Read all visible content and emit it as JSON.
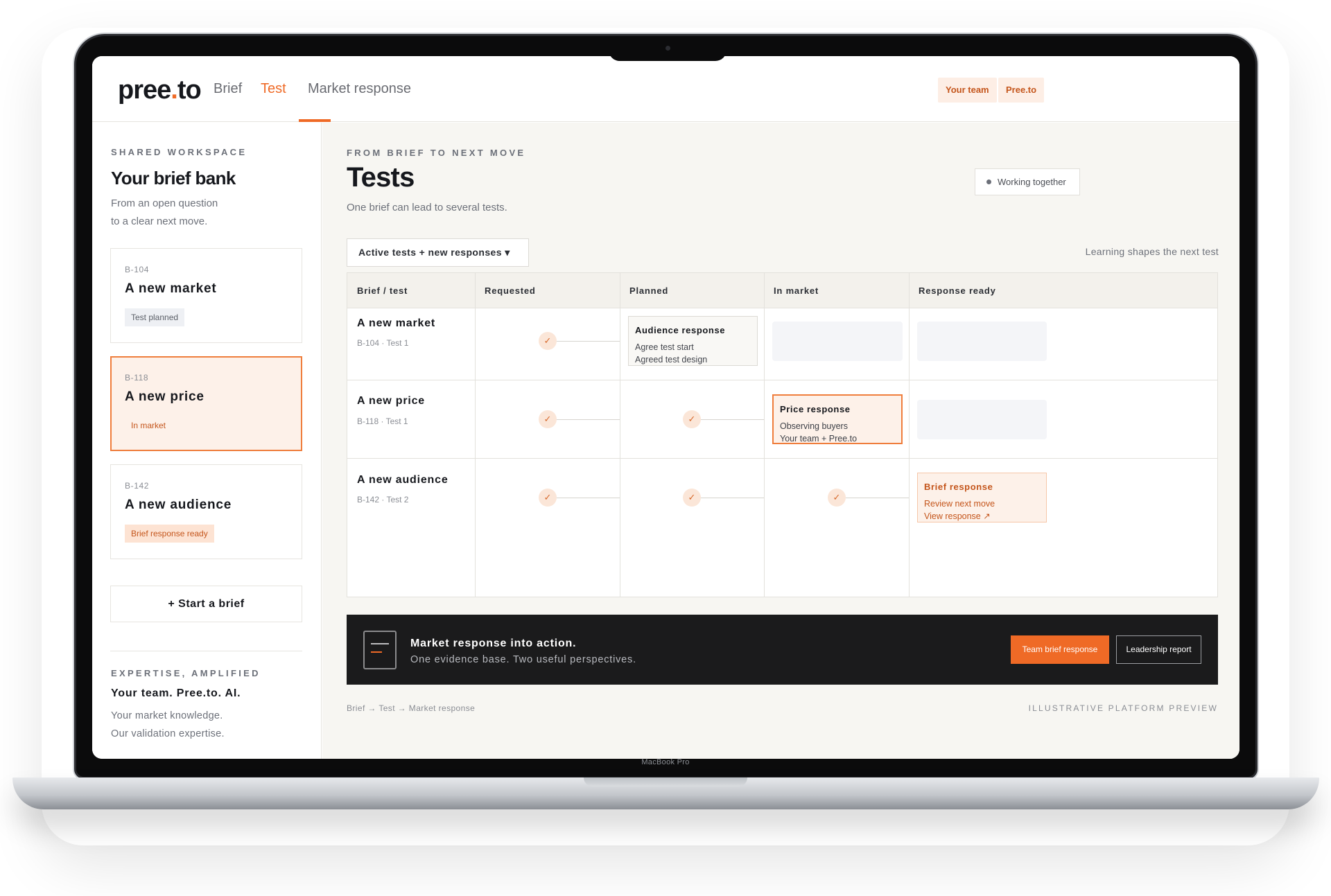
{
  "device": {
    "label": "MacBook Pro"
  },
  "topbar": {
    "logo_main": "pree",
    "logo_dot": ".",
    "logo_end": "to",
    "nav": [
      "Brief",
      "Test",
      "Market response"
    ],
    "active_nav": "Test",
    "chips": [
      "Your team",
      "Pree.to"
    ]
  },
  "sidebar": {
    "eyebrow": "SHARED WORKSPACE",
    "title": "Your brief bank",
    "subtitle_line1": "From an open question",
    "subtitle_line2": "to a clear next move.",
    "cards": [
      {
        "id": "B-104",
        "title": "A new market",
        "badge": "Test planned"
      },
      {
        "id": "B-118",
        "title": "A new price",
        "badge": "In market"
      },
      {
        "id": "B-142",
        "title": "A new audience",
        "badge": "Brief response ready"
      }
    ],
    "start_button": "+ Start a brief",
    "footer_eyebrow": "EXPERTISE, AMPLIFIED",
    "footer_title": "Your team. Pree.to. AI.",
    "footer_line1": "Your market knowledge.",
    "footer_line2": "Our validation expertise."
  },
  "main": {
    "eyebrow": "FROM BRIEF TO NEXT MOVE",
    "title": "Tests",
    "subtitle": "One brief can lead to several tests.",
    "status_chip": "Working together",
    "filter": "Active tests + new responses ▾",
    "learning_note": "Learning shapes the next test"
  },
  "table": {
    "columns": [
      "Brief / test",
      "Requested",
      "Planned",
      "In market",
      "Response ready"
    ],
    "rows": [
      {
        "title": "A new market",
        "id": "B-104 · Test 1",
        "card": {
          "title": "Audience response",
          "lines": [
            "Agree test start",
            "Agreed test design"
          ]
        }
      },
      {
        "title": "A new price",
        "id": "B-118 · Test 1",
        "card": {
          "title": "Price response",
          "lines": [
            "Observing buyers",
            "Your team + Pree.to"
          ]
        }
      },
      {
        "title": "A new audience",
        "id": "B-142 · Test 2",
        "card": {
          "title": "Brief response",
          "lines": [
            "Review next move",
            "View response ↗"
          ]
        }
      }
    ],
    "check_glyph": "✓"
  },
  "banner": {
    "title": "Market response into action.",
    "subtitle": "One evidence base. Two useful perspectives.",
    "primary_button": "Team brief response",
    "secondary_button": "Leadership report"
  },
  "footer": {
    "breadcrumb": "Brief → Test → Market response",
    "note": "ILLUSTRATIVE PLATFORM PREVIEW"
  },
  "colors": {
    "accent": "#ef6a26",
    "accent_soft": "#fdf1e9",
    "text_primary": "#16181d",
    "text_muted": "#6c7079",
    "banner_bg": "#1b1b1c"
  }
}
